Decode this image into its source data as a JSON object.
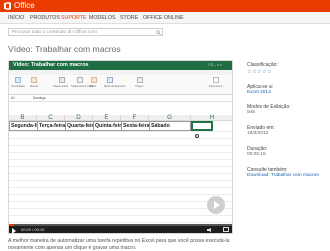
{
  "header": {
    "brand": "Office"
  },
  "nav": {
    "items": [
      {
        "label": "INÍCIO",
        "active": false
      },
      {
        "label": "PRODUTOS",
        "active": false
      },
      {
        "label": "SUPORTE",
        "active": true
      },
      {
        "label": "MODELOS",
        "active": false
      },
      {
        "label": "STORE",
        "active": false
      },
      {
        "label": "OFFICE ONLINE",
        "active": false
      }
    ]
  },
  "search": {
    "placeholder": "Procurar todo o conteúdo do Office.com"
  },
  "page": {
    "title": "Vídeo: Trabalhar com macros"
  },
  "video": {
    "excel_title": "Vídeo: Trabalhar com macros",
    "excel_title_right": "? ⊡ – □ ×",
    "ribbon_labels": [
      "Visual Basic",
      "Macros",
      "Suplementos",
      "Suplementos COM",
      "Inserir",
      "Modo de Estrutura",
      "Origem",
      "Documento"
    ],
    "name_box": "A1",
    "formula": "Domingo",
    "columns": [
      "B",
      "C",
      "D",
      "E",
      "F",
      "G",
      "H"
    ],
    "row_cells": [
      "Segunda-fe",
      "Terça-feira",
      "Quarta-feir",
      "Quinta-feir",
      "Sexta-feira",
      "Sábado"
    ],
    "progress": 0.02,
    "time": "00:00 / 00:15"
  },
  "description": "A melhor maneira de automatizar uma tarefa repetitiva no Excel para que você possa executá-la novamente com apenas um clique é gravar uma macro.",
  "sidebar": {
    "rating_label": "Classificação:",
    "rating_stars": "☆☆☆☆☆",
    "applies_label": "Aplica-se a:",
    "applies_value": "Excel 2013",
    "views_label": "Modos de Exibição:",
    "views_value": "545",
    "sent_label": "Enviado em:",
    "sent_value": "18/3/2013",
    "duration_label": "Duração:",
    "duration_value": "00:05:15",
    "see_also_label": "Consulte também:",
    "see_also_link": "Download: Trabalhar com macros"
  },
  "colors": {
    "brand": "#eb3c00",
    "excel_green": "#1f6e43",
    "link": "#1e5fad"
  }
}
